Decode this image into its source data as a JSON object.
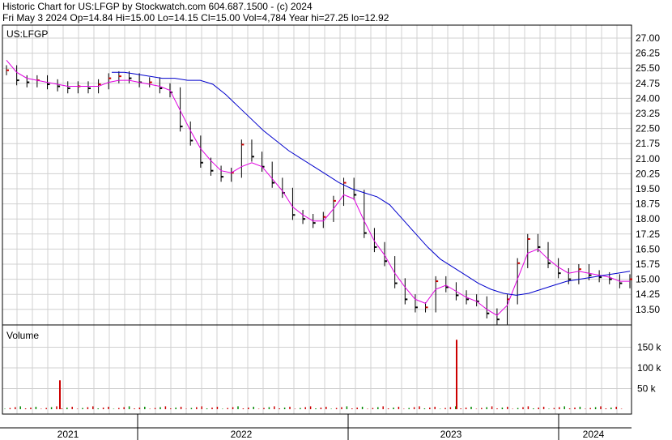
{
  "header": {
    "line1": "Historic Chart for US:LFGP by Stockwatch.com 604.687.1500 - (c) 2024",
    "line2": "Fri May  3 2024  Op=14.84  Hi=15.00  Lo=14.15  Cl=15.00  Vol=4,784  Year hi=27.25  lo=12.92"
  },
  "chart_data": [
    {
      "type": "line",
      "symbol_label": "US:LFGP",
      "y_ticks": [
        "27.00",
        "26.25",
        "25.50",
        "24.75",
        "24.00",
        "23.25",
        "22.50",
        "21.75",
        "21.00",
        "20.25",
        "19.50",
        "18.75",
        "18.00",
        "17.25",
        "16.50",
        "15.75",
        "15.00",
        "14.25",
        "13.50"
      ],
      "ylim": [
        12.9,
        27.5
      ],
      "x_labels": [
        "2021",
        "2022",
        "2023",
        "2024"
      ],
      "price": [
        25.4,
        24.9,
        24.8,
        24.9,
        24.7,
        24.6,
        24.5,
        24.6,
        24.5,
        24.7,
        25.0,
        25.1,
        25.0,
        24.8,
        24.8,
        24.5,
        24.3,
        22.6,
        21.9,
        20.8,
        20.4,
        20.1,
        20.3,
        21.7,
        21.1,
        20.6,
        19.8,
        19.3,
        18.2,
        18.0,
        17.8,
        18.1,
        18.9,
        19.8,
        19.2,
        17.3,
        16.6,
        15.9,
        14.8,
        14.0,
        13.6,
        13.6,
        14.9,
        14.6,
        14.2,
        14.0,
        13.9,
        13.3,
        13.0,
        14.0,
        15.8,
        17.0,
        16.6,
        15.8,
        15.3,
        15.0,
        15.5,
        15.2,
        15.1,
        15.0,
        14.8,
        15.0
      ],
      "ma_short": [
        25.9,
        25.3,
        25.0,
        24.9,
        24.8,
        24.7,
        24.6,
        24.6,
        24.6,
        24.6,
        24.8,
        24.9,
        24.9,
        24.8,
        24.7,
        24.6,
        24.4,
        23.4,
        22.4,
        21.5,
        20.9,
        20.4,
        20.3,
        20.6,
        20.8,
        20.6,
        20.0,
        19.4,
        18.6,
        18.2,
        17.9,
        17.9,
        18.5,
        19.2,
        19.0,
        17.9,
        16.9,
        16.2,
        15.3,
        14.6,
        14.0,
        13.8,
        14.5,
        14.7,
        14.4,
        14.1,
        13.9,
        13.5,
        13.2,
        13.7,
        15.0,
        16.3,
        16.5,
        16.0,
        15.6,
        15.3,
        15.4,
        15.3,
        15.2,
        15.1,
        14.9,
        14.9
      ],
      "ma_long": [
        25.3,
        25.3,
        25.2,
        25.1,
        25.0,
        25.0,
        24.9,
        24.9,
        24.7,
        24.2,
        23.6,
        23.0,
        22.4,
        21.9,
        21.4,
        21.0,
        20.6,
        20.2,
        19.8,
        19.5,
        19.3,
        19.1,
        18.7,
        18.0,
        17.3,
        16.6,
        16.0,
        15.6,
        15.2,
        14.8,
        14.5,
        14.3,
        14.2,
        14.3,
        14.5,
        14.7,
        14.9,
        15.0,
        15.1,
        15.2,
        15.3,
        15.4
      ],
      "volume_axis": [
        "150 k",
        "100 k",
        "50 k"
      ],
      "volume_title": "Volume",
      "volume_spikes_k": [
        70,
        168
      ],
      "colors": {
        "price": "#000000",
        "up": "#cc0000",
        "ma_short": "#e000e0",
        "ma_long": "#0000cc",
        "vol_up": "#008800",
        "vol_down": "#cc0000"
      }
    }
  ]
}
